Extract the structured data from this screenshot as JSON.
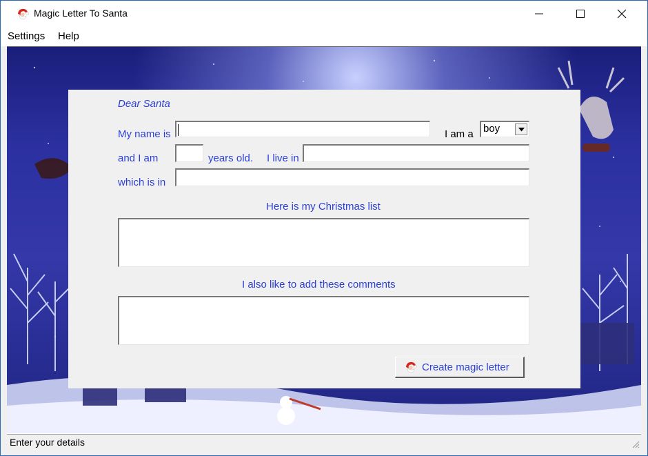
{
  "window": {
    "title": "Magic Letter To Santa",
    "icon": "santa-icon"
  },
  "menu": {
    "items": [
      "Settings",
      "Help"
    ]
  },
  "form": {
    "greeting": "Dear Santa",
    "name_label": "My name is",
    "name_value": "",
    "gender_label": "I am a",
    "gender_value": "boy",
    "age_label": "and  I  am",
    "age_value": "",
    "years_label": "years old.",
    "live_label": "I live in",
    "live_value": "",
    "which_label": "which  is in",
    "which_value": "",
    "list_heading": "Here is my Christmas list",
    "list_value": "",
    "comments_heading": "I also like to add these comments",
    "comments_value": "",
    "create_button_label": "Create magic letter"
  },
  "status": {
    "text": "Enter your details"
  },
  "colors": {
    "label_blue": "#2b3fd8",
    "scene_blue": "#2b30a0",
    "panel_gray": "#f0f0f0"
  }
}
